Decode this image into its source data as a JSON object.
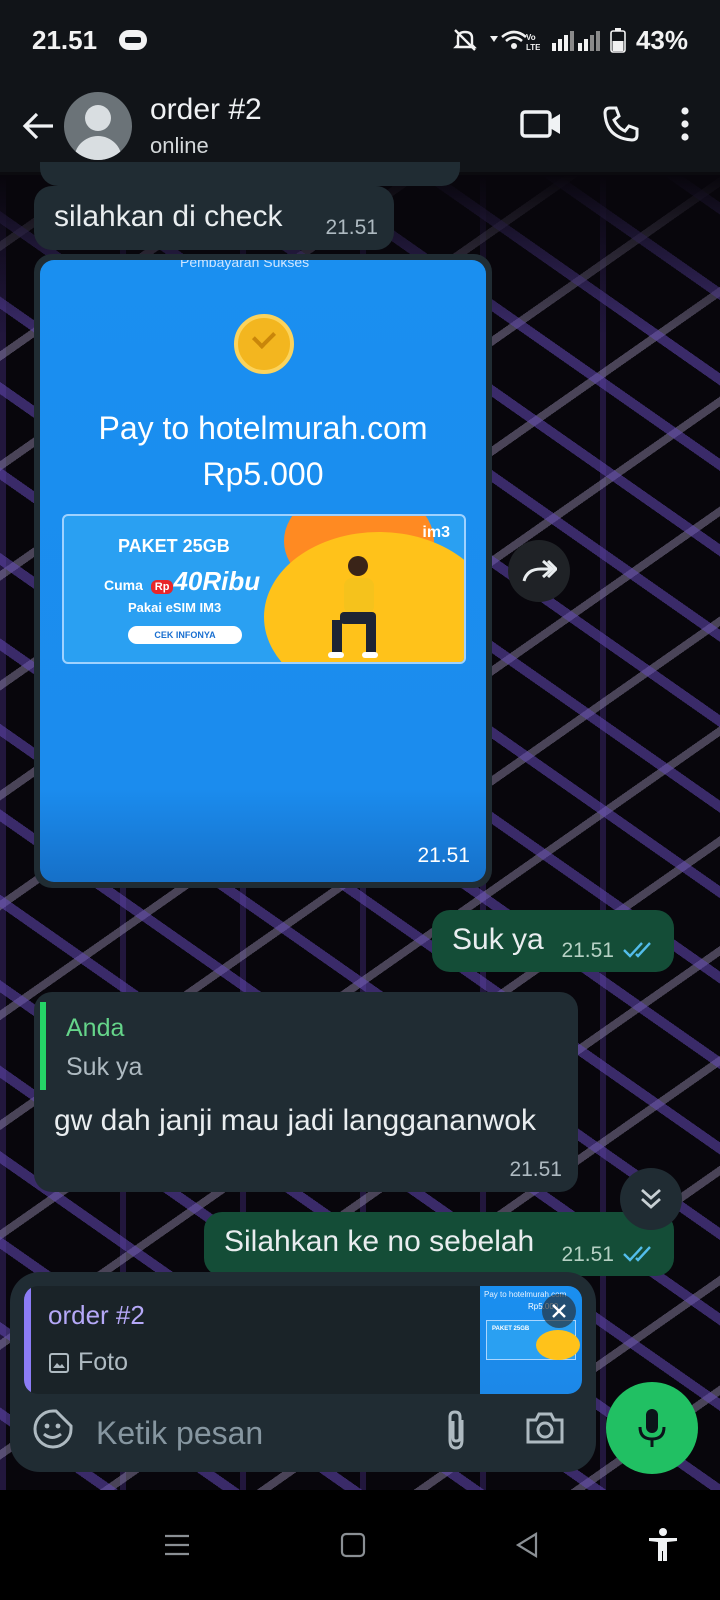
{
  "status_bar": {
    "time": "21.51",
    "battery": "43%",
    "icons": [
      "notification-off-icon",
      "wifi-icon",
      "volte-icon",
      "signal-icon",
      "battery-icon"
    ]
  },
  "header": {
    "title": "order #2",
    "subtitle": "online",
    "icons": [
      "back-arrow-icon",
      "video-call-icon",
      "voice-call-icon",
      "more-menu-icon"
    ]
  },
  "messages": [
    {
      "direction": "in",
      "text": "silahkan di check",
      "time": "21.51"
    },
    {
      "direction": "in",
      "type": "image",
      "time": "21.51",
      "image": {
        "cut_header": "Pembayaran Sukses",
        "pay_to": "Pay to hotelmurah.com",
        "amount": "Rp5.000",
        "ad": {
          "headline": "PAKET 25GB",
          "price_prefix": "Cuma",
          "price_currency": "Rp",
          "price": "40Ribu",
          "sub": "Pakai eSIM IM3",
          "button": "CEK INFONYA",
          "brand": "im3"
        }
      }
    },
    {
      "direction": "out",
      "text": "Suk ya",
      "time": "21.51",
      "status": "read"
    },
    {
      "direction": "in",
      "quote": {
        "name": "Anda",
        "text": "Suk ya"
      },
      "text": "gw dah janji mau jadi langgananwok",
      "time": "21.51"
    },
    {
      "direction": "out",
      "text": "Silahkan ke no sebelah",
      "time": "21.51",
      "status": "read"
    }
  ],
  "reply_preview": {
    "name": "order #2",
    "type_label": "Foto",
    "thumb_caption": "Pay to hotelmurah.com",
    "thumb_amount": "Rp5.000",
    "thumb_ad": "PAKET 25GB"
  },
  "composer": {
    "placeholder": "Ketik pesan"
  },
  "colors": {
    "incoming_bubble": "#202c33",
    "outgoing_bubble": "#144d37",
    "accent_green": "#21c063",
    "quote_bar": "#25d366",
    "reply_bar": "#8c7cf5",
    "read_ticks": "#53bdeb"
  }
}
